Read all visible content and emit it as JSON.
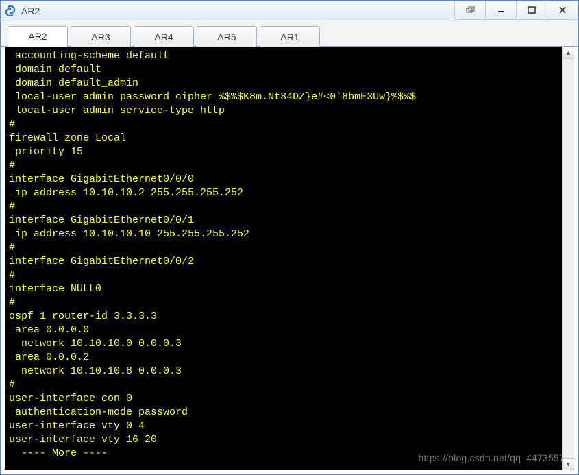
{
  "window": {
    "title": "AR2"
  },
  "tabs": [
    {
      "label": "AR2",
      "active": true
    },
    {
      "label": "AR3",
      "active": false
    },
    {
      "label": "AR4",
      "active": false
    },
    {
      "label": "AR5",
      "active": false
    },
    {
      "label": "AR1",
      "active": false
    }
  ],
  "terminal": {
    "lines": [
      " accounting-scheme default",
      " domain default",
      " domain default_admin",
      " local-user admin password cipher %$%$K8m.Nt84DZ}e#<0`8bmE3Uw}%$%$",
      " local-user admin service-type http",
      "#",
      "firewall zone Local",
      " priority 15",
      "#",
      "interface GigabitEthernet0/0/0",
      " ip address 10.10.10.2 255.255.255.252",
      "#",
      "interface GigabitEthernet0/0/1",
      " ip address 10.10.10.10 255.255.255.252",
      "#",
      "interface GigabitEthernet0/0/2",
      "#",
      "interface NULL0",
      "#",
      "ospf 1 router-id 3.3.3.3",
      " area 0.0.0.0",
      "  network 10.10.10.0 0.0.0.3",
      " area 0.0.0.2",
      "  network 10.10.10.8 0.0.0.3",
      "#",
      "user-interface con 0",
      " authentication-mode password",
      "user-interface vty 0 4",
      "user-interface vty 16 20",
      "  ---- More ----"
    ]
  },
  "watermark": "https://blog.csdn.net/qq_4473557"
}
